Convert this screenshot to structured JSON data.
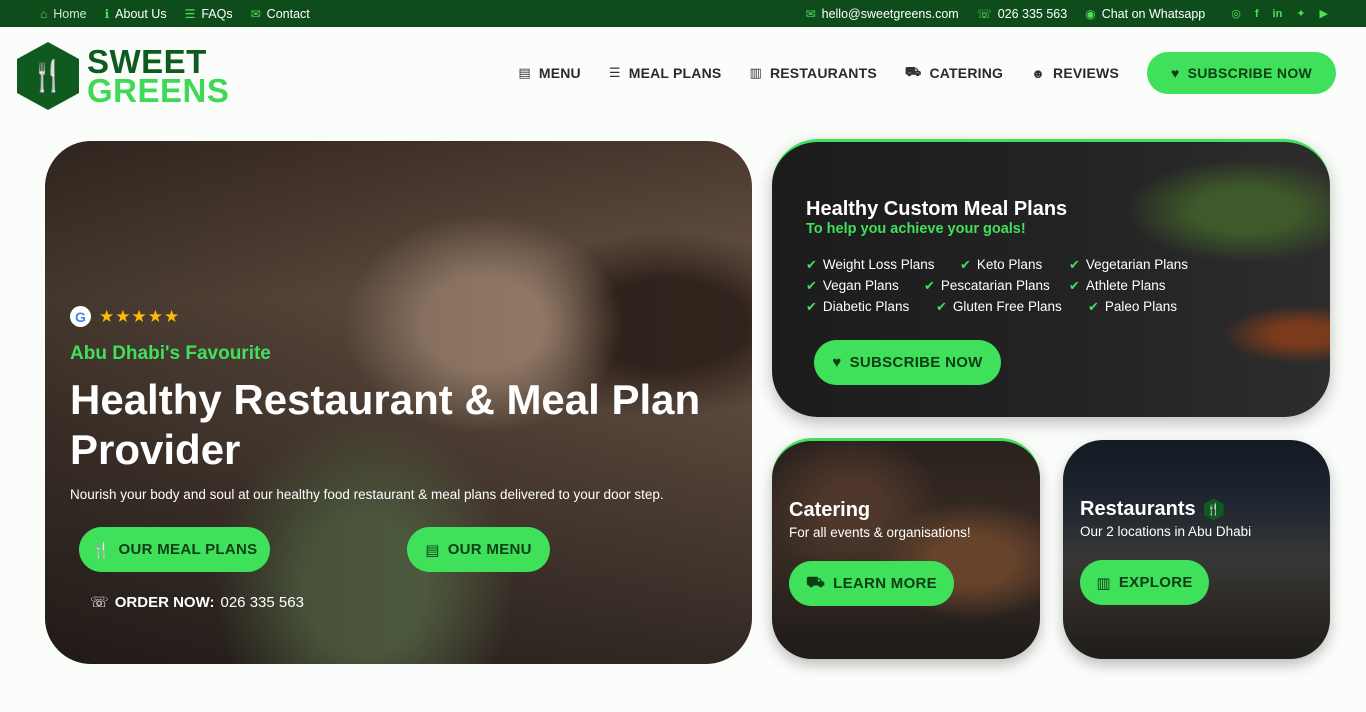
{
  "topbar": {
    "left": [
      {
        "icon": "home-icon",
        "glyph": "⌂",
        "label": "Home"
      },
      {
        "icon": "info-icon",
        "glyph": "ℹ",
        "label": "About Us"
      },
      {
        "icon": "list-icon",
        "glyph": "☰",
        "label": "FAQs"
      },
      {
        "icon": "mail-icon",
        "glyph": "✉",
        "label": "Contact"
      }
    ],
    "right": [
      {
        "icon": "mail-icon",
        "glyph": "✉",
        "label": "hello@sweetgreens.com"
      },
      {
        "icon": "phone-icon",
        "glyph": "☏",
        "label": "026 335 563"
      },
      {
        "icon": "whatsapp-icon",
        "glyph": "◉",
        "label": "Chat on Whatsapp"
      }
    ],
    "social": [
      "instagram-icon",
      "facebook-icon",
      "linkedin-icon",
      "twitter-icon",
      "youtube-icon"
    ]
  },
  "logo": {
    "line1": "SWEET",
    "line2": "GREENS"
  },
  "nav": {
    "items": [
      {
        "icon": "menu-icon",
        "glyph": "▤",
        "label": "MENU"
      },
      {
        "icon": "list-icon",
        "glyph": "☰",
        "label": "MEAL PLANS"
      },
      {
        "icon": "building-icon",
        "glyph": "▥",
        "label": "RESTAURANTS"
      },
      {
        "icon": "truck-icon",
        "glyph": "⛟",
        "label": "CATERING"
      },
      {
        "icon": "smile-icon",
        "glyph": "☻",
        "label": "REVIEWS"
      }
    ],
    "subscribe": "SUBSCRIBE NOW"
  },
  "hero": {
    "kicker": "Abu Dhabi's Favourite",
    "title": "Healthy Restaurant & Meal Plan Provider",
    "subtitle": "Nourish your body and soul at our healthy food restaurant & meal plans delivered to your door step.",
    "stars": "★★★★★",
    "btn_meal_plans": "OUR MEAL PLANS",
    "btn_menu": "OUR MENU",
    "order_label": "ORDER NOW:",
    "order_phone": "026 335 563"
  },
  "plans": {
    "title": "Healthy Custom Meal Plans",
    "subtitle": "To help you achieve your goals!",
    "rows": [
      [
        "Weight Loss Plans",
        "Keto Plans",
        "Vegetarian Plans"
      ],
      [
        "Vegan Plans",
        "Pescatarian Plans",
        "Athlete Plans"
      ],
      [
        "Diabetic Plans",
        "Gluten Free Plans",
        "Paleo Plans"
      ]
    ],
    "button": "SUBSCRIBE NOW"
  },
  "catering": {
    "title": "Catering",
    "subtitle": "For all events & organisations!",
    "button": "LEARN MORE"
  },
  "restaurants": {
    "title": "Restaurants",
    "subtitle": "Our 2 locations in Abu Dhabi",
    "button": "EXPLORE"
  }
}
